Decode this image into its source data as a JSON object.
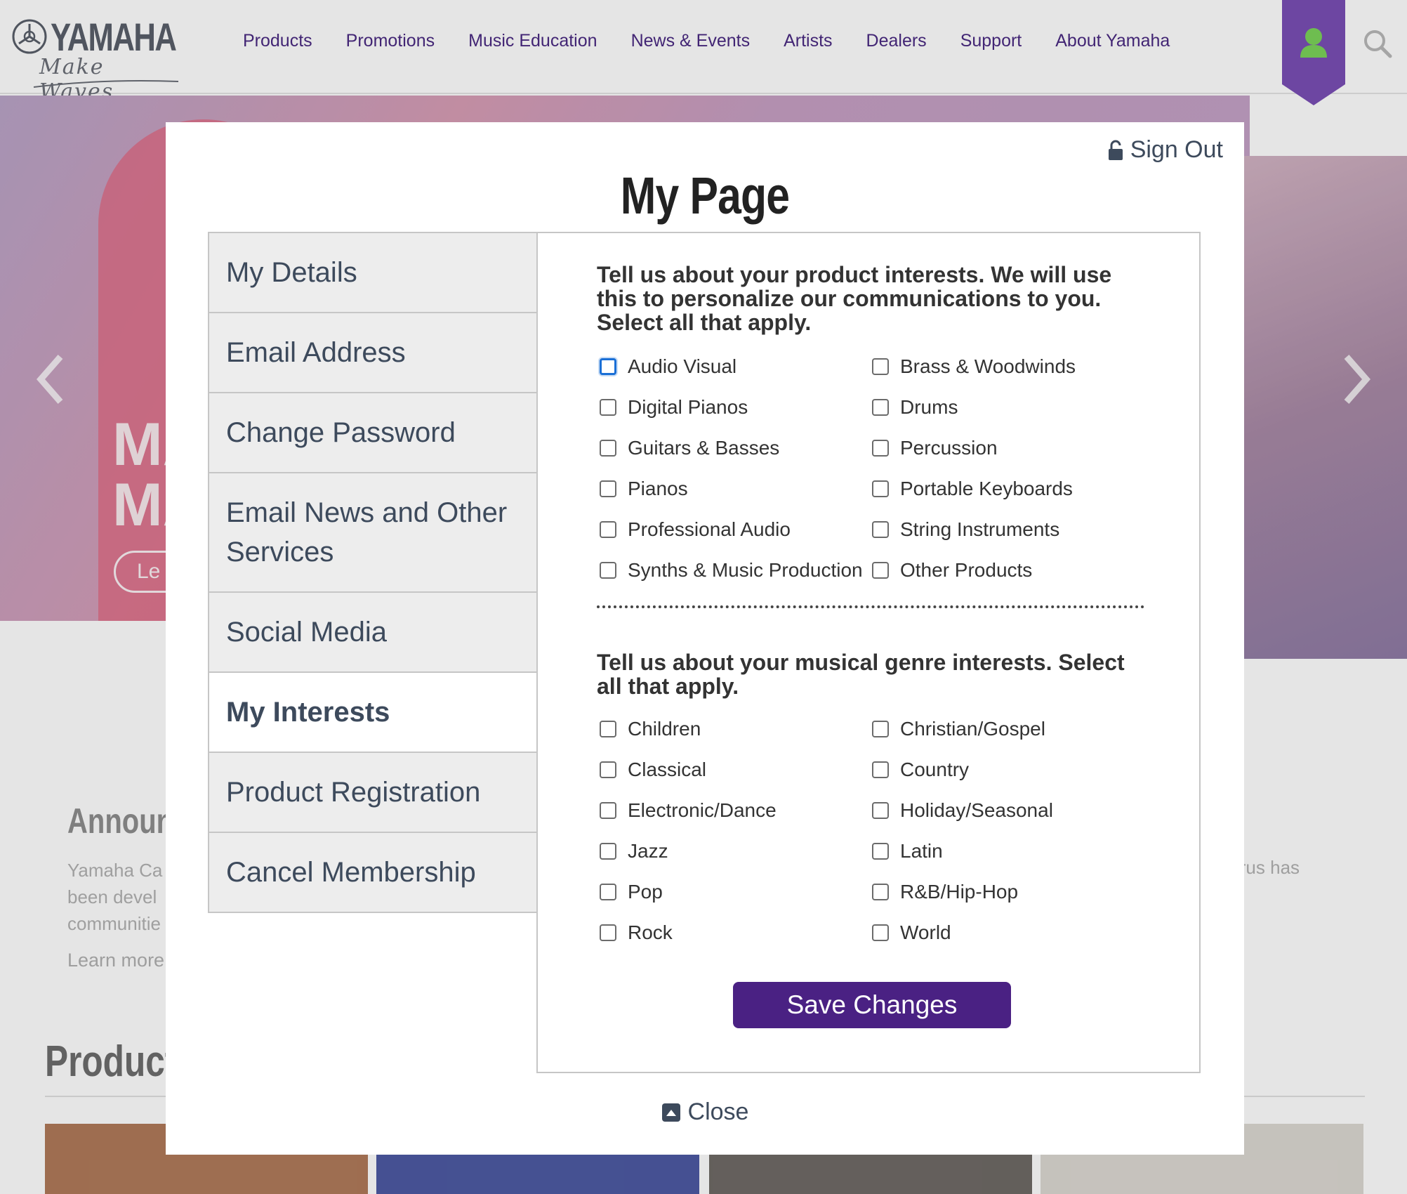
{
  "header": {
    "logo_text": "YAMAHA",
    "logo_tagline": "Make Waves",
    "nav": [
      "Products",
      "Promotions",
      "Music Education",
      "News & Events",
      "Artists",
      "Dealers",
      "Support",
      "About Yamaha"
    ],
    "accent_color": "#7a4fb5",
    "nav_color": "#4a2a82",
    "icons": {
      "user": "user-icon",
      "search": "search-icon"
    }
  },
  "background": {
    "hero_title_partial": "MA\nMA",
    "hero_button_partial": "Le",
    "announce_title_partial": "Announc",
    "announce_text_partial": "Yamaha Ca\nbeen devel\ncommunitie",
    "announce_link_partial": "Learn more",
    "right_text_partial": "irus has",
    "products_title_partial": "Products"
  },
  "modal": {
    "signout_label": "Sign Out",
    "title": "My Page",
    "close_label": "Close",
    "menu": [
      {
        "label": "My Details",
        "active": false
      },
      {
        "label": "Email Address",
        "active": false
      },
      {
        "label": "Change Password",
        "active": false
      },
      {
        "label": "Email News and Other Services",
        "active": false
      },
      {
        "label": "Social Media",
        "active": false
      },
      {
        "label": "My Interests",
        "active": true
      },
      {
        "label": "Product Registration",
        "active": false
      },
      {
        "label": "Cancel Membership",
        "active": false
      }
    ],
    "product_heading": "Tell us about your product interests. We will use this to personalize our communications to you. Select all that apply.",
    "products": [
      {
        "label": "Audio Visual",
        "checked": false,
        "focused": true
      },
      {
        "label": "Brass & Woodwinds",
        "checked": false
      },
      {
        "label": "Digital Pianos",
        "checked": false
      },
      {
        "label": "Drums",
        "checked": false
      },
      {
        "label": "Guitars & Basses",
        "checked": false
      },
      {
        "label": "Percussion",
        "checked": false
      },
      {
        "label": "Pianos",
        "checked": false
      },
      {
        "label": "Portable Keyboards",
        "checked": false
      },
      {
        "label": "Professional Audio",
        "checked": false
      },
      {
        "label": "String Instruments",
        "checked": false
      },
      {
        "label": "Synths & Music Production",
        "checked": false
      },
      {
        "label": "Other Products",
        "checked": false
      }
    ],
    "genre_heading": "Tell us about your musical genre interests. Select all that apply.",
    "genres": [
      {
        "label": "Children",
        "checked": false
      },
      {
        "label": "Christian/Gospel",
        "checked": false
      },
      {
        "label": "Classical",
        "checked": false
      },
      {
        "label": "Country",
        "checked": false
      },
      {
        "label": "Electronic/Dance",
        "checked": false
      },
      {
        "label": "Holiday/Seasonal",
        "checked": false
      },
      {
        "label": "Jazz",
        "checked": false
      },
      {
        "label": "Latin",
        "checked": false
      },
      {
        "label": "Pop",
        "checked": false
      },
      {
        "label": "R&B/Hip-Hop",
        "checked": false
      },
      {
        "label": "Rock",
        "checked": false
      },
      {
        "label": "World",
        "checked": false
      }
    ],
    "save_label": "Save Changes",
    "button_color": "#4a2183"
  }
}
